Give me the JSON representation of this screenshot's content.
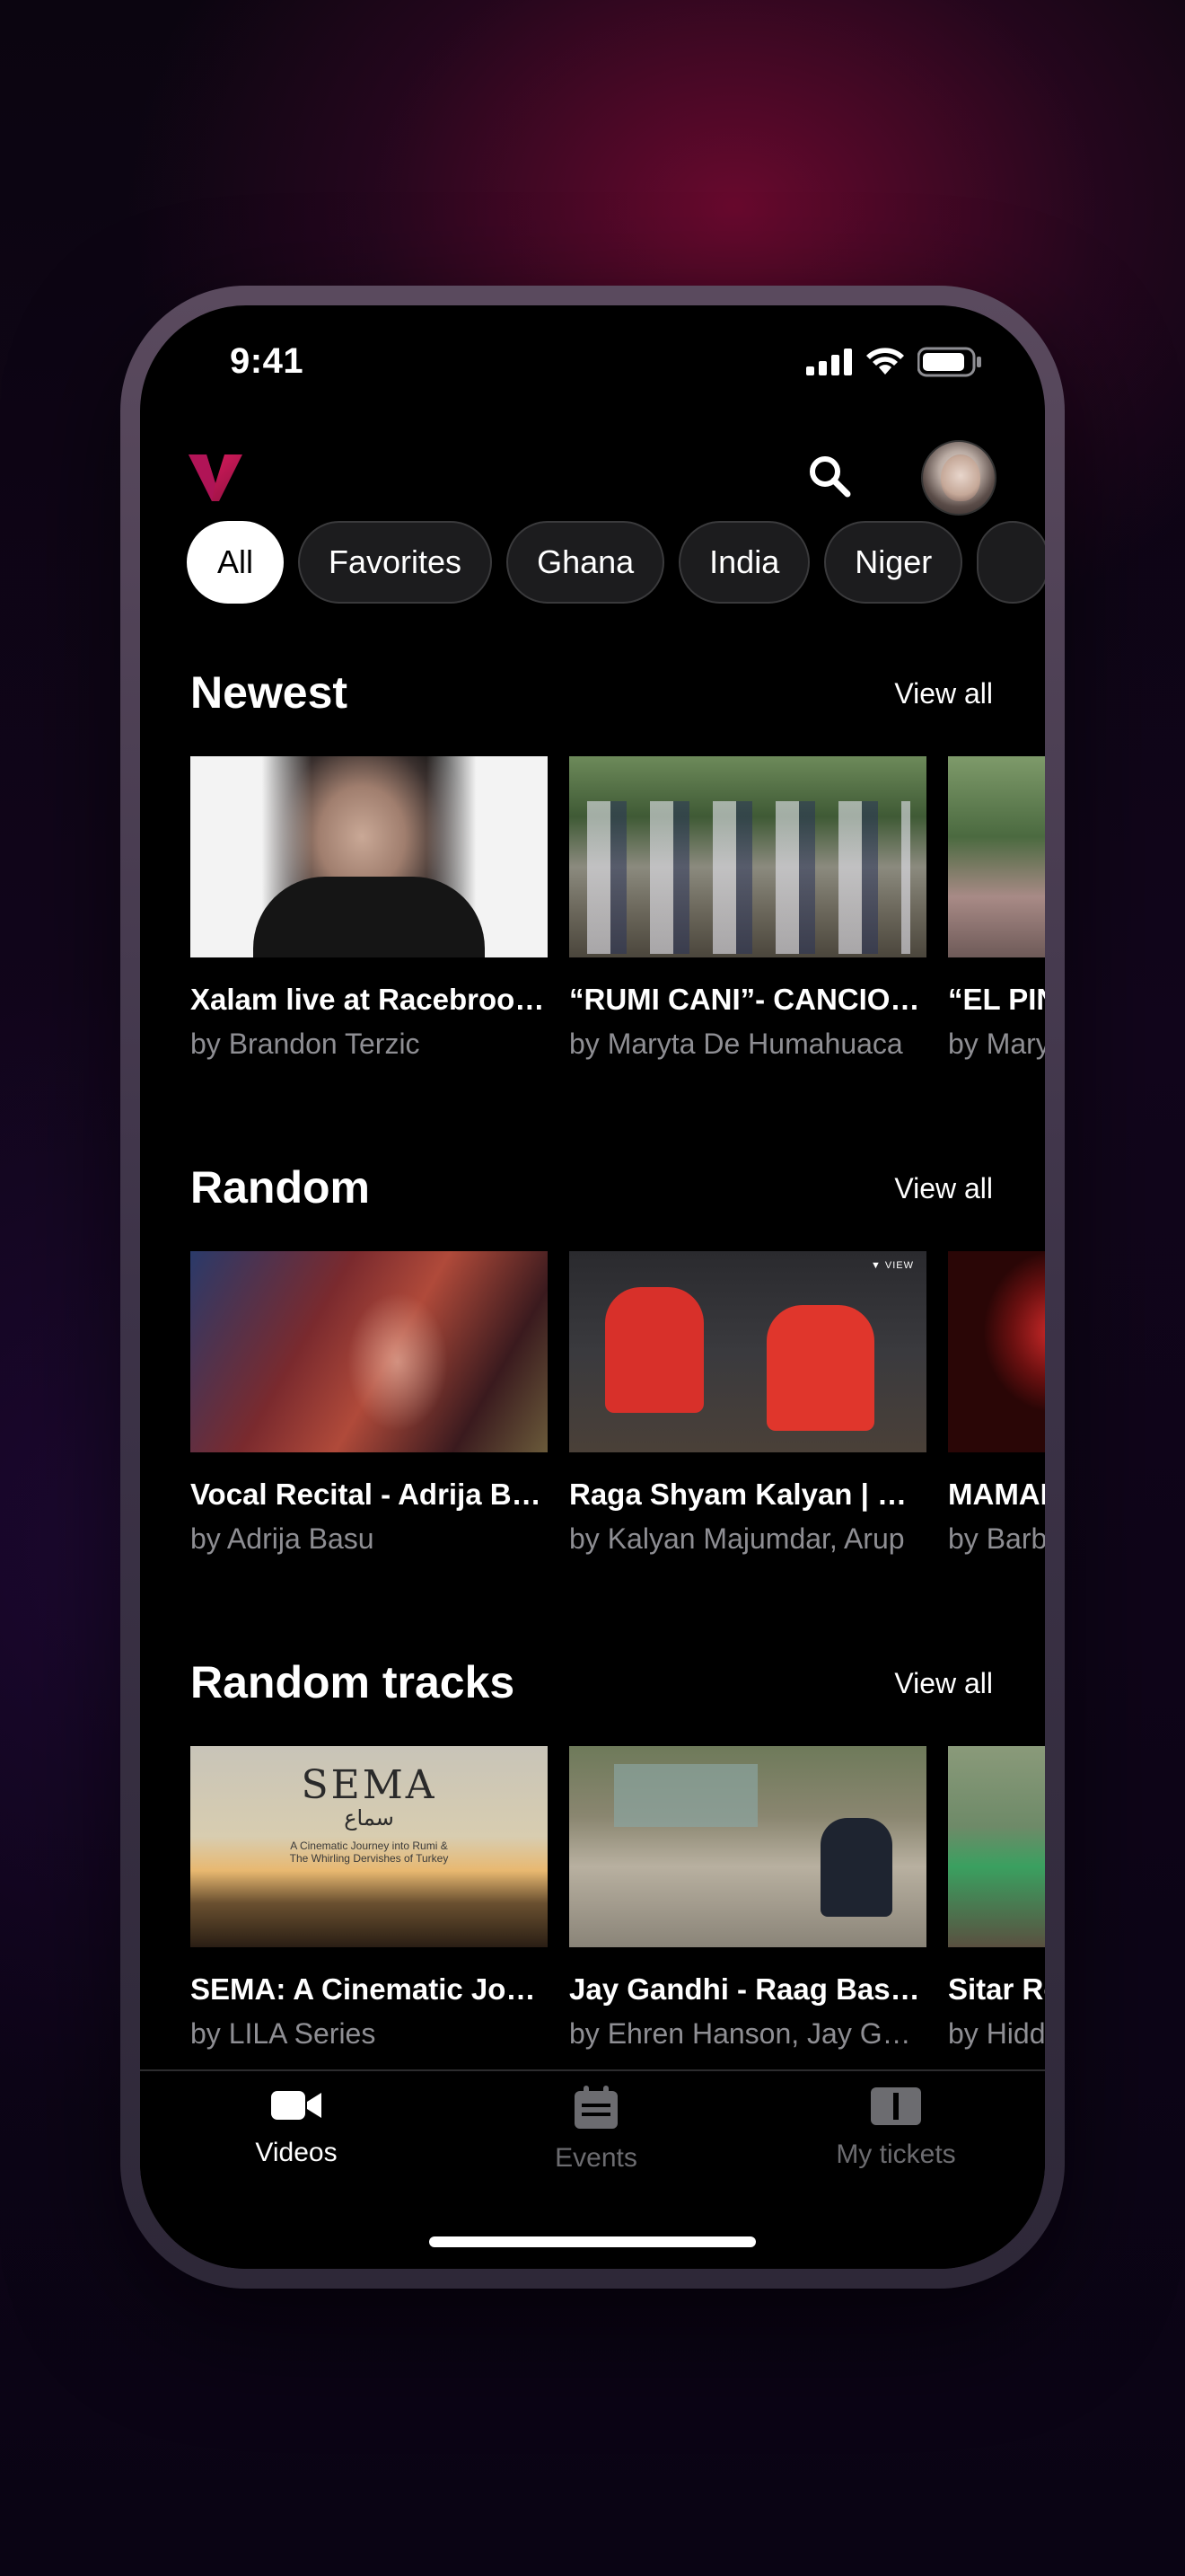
{
  "status_bar": {
    "time": "9:41"
  },
  "filters": [
    "All",
    "Favorites",
    "Ghana",
    "India",
    "Niger",
    ""
  ],
  "sections": [
    {
      "title": "Newest",
      "view_all": "View all",
      "cards": [
        {
          "title": "Xalam live at Racebrook Studio",
          "subtitle": "by Brandon Terzic",
          "thumb": "portrait"
        },
        {
          "title": "“RUMI CANI”- CANCIONES",
          "subtitle": "by Maryta De Humahuaca",
          "thumb": "crowd"
        },
        {
          "title": "“EL PIN",
          "subtitle": "by Mary",
          "thumb": "crowd3"
        }
      ]
    },
    {
      "title": "Random",
      "view_all": "View all",
      "cards": [
        {
          "title": "Vocal Recital - Adrija Basu",
          "subtitle": "by Adrija Basu",
          "thumb": "recital"
        },
        {
          "title": "Raga Shyam Kalyan | Kalyan",
          "subtitle": "by Kalyan Majumdar, Arup",
          "thumb": "raga"
        },
        {
          "title": "MAMAI",
          "subtitle": "by Barb",
          "thumb": "red"
        }
      ]
    },
    {
      "title": "Random tracks",
      "view_all": "View all",
      "cards": [
        {
          "title": "SEMA: A Cinematic Journey",
          "subtitle": "by LILA Series",
          "thumb": "sema"
        },
        {
          "title": "Jay Gandhi - Raag Basant",
          "subtitle": "by Ehren Hanson, Jay Gandhi",
          "thumb": "gandhi"
        },
        {
          "title": "Sitar Re",
          "subtitle": "by Hidd",
          "thumb": "sitar"
        }
      ]
    }
  ],
  "sema_thumb": {
    "title": "SEMA",
    "arabic": "سماع",
    "tagline_1": "A Cinematic Journey into Rumi &",
    "tagline_2": "The Whirling Dervishes of Turkey"
  },
  "tabs": [
    {
      "label": "Videos",
      "icon": "video-camera-icon",
      "active": true
    },
    {
      "label": "Events",
      "icon": "calendar-icon",
      "active": false
    },
    {
      "label": "My tickets",
      "icon": "ticket-icon",
      "active": false
    }
  ],
  "colors": {
    "brand": "#c2185b",
    "background": "#000000",
    "muted": "#8e8e93"
  }
}
